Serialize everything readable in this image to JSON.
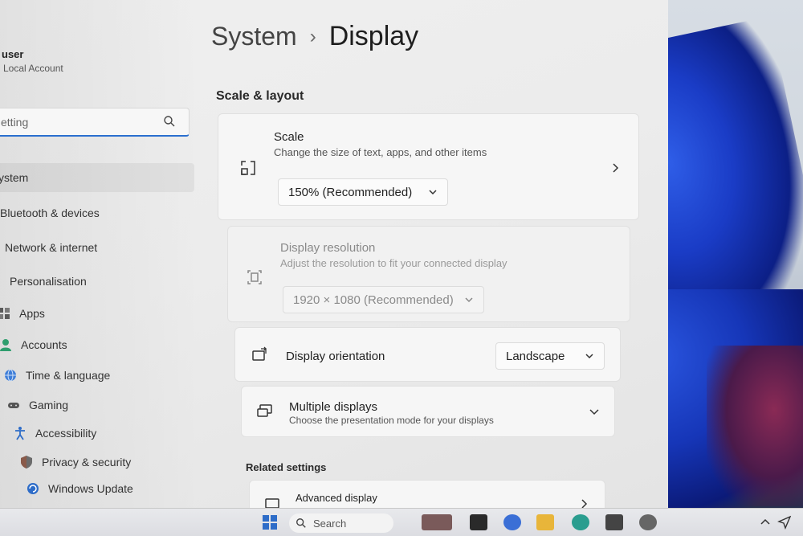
{
  "sidebar": {
    "user_name": "user",
    "user_sub": "Local Account",
    "search_value": "etting",
    "items": [
      {
        "label": "ystem",
        "icon": "system-icon"
      },
      {
        "label": "Bluetooth & devices",
        "icon": "bluetooth-icon"
      },
      {
        "label": "Network & internet",
        "icon": "network-icon"
      },
      {
        "label": "Personalisation",
        "icon": "personalisation-icon"
      },
      {
        "label": "Apps",
        "icon": "apps-icon"
      },
      {
        "label": "Accounts",
        "icon": "accounts-icon"
      },
      {
        "label": "Time & language",
        "icon": "globe-icon"
      },
      {
        "label": "Gaming",
        "icon": "gamepad-icon"
      },
      {
        "label": "Accessibility",
        "icon": "accessibility-icon"
      },
      {
        "label": "Privacy & security",
        "icon": "shield-icon"
      },
      {
        "label": "Windows Update",
        "icon": "update-icon"
      }
    ]
  },
  "header": {
    "parent": "System",
    "separator": "›",
    "current": "Display"
  },
  "sections": {
    "scale_layout": "Scale & layout",
    "related": "Related settings"
  },
  "scale": {
    "title": "Scale",
    "subtitle": "Change the size of text, apps, and other items",
    "value": "150% (Recommended)"
  },
  "resolution": {
    "title": "Display resolution",
    "subtitle": "Adjust the resolution to fit your connected display",
    "value": "1920 × 1080 (Recommended)"
  },
  "orientation": {
    "title": "Display orientation",
    "value": "Landscape"
  },
  "multiple": {
    "title": "Multiple displays",
    "subtitle": "Choose the presentation mode for your displays"
  },
  "advanced": {
    "title": "Advanced display"
  },
  "taskbar": {
    "search_label": "Search"
  },
  "colors": {
    "accent": "#2a6fcf",
    "window_bg": "#eeeeee",
    "card_bg": "#f6f6f6"
  }
}
